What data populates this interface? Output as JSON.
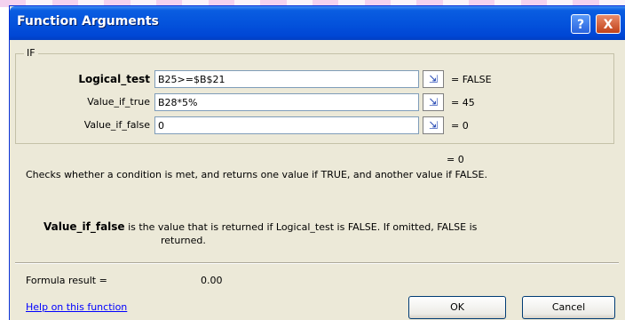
{
  "window": {
    "title": "Function Arguments"
  },
  "titlebar_buttons": {
    "help": "?",
    "close": "X"
  },
  "group": {
    "label": "IF"
  },
  "arguments": [
    {
      "label": "Logical_test",
      "value": "B25>=$B$21",
      "result": "= FALSE"
    },
    {
      "label": "Value_if_true",
      "value": "B28*5%",
      "result": "= 45"
    },
    {
      "label": "Value_if_false",
      "value": "0",
      "result": "= 0"
    }
  ],
  "overall_result": "= 0",
  "description": "Checks whether a condition is met, and returns one value if TRUE, and another value if FALSE.",
  "arg_help": {
    "name": "Value_if_false",
    "text": "is the value that is returned if Logical_test is FALSE. If omitted, FALSE is",
    "text_cont": "returned."
  },
  "formula": {
    "label": "Formula result =",
    "value": "0.00"
  },
  "help_link": "Help on this function",
  "buttons": {
    "ok": "OK",
    "cancel": "Cancel"
  },
  "colors": {
    "titlebar": "#0453dc",
    "dialog_bg": "#ece9d8",
    "link": "#0000ff",
    "stripe": "#f4d2ef"
  },
  "icons": {
    "collapse": "collapse-dialog-icon",
    "help": "question-mark-icon",
    "close": "close-icon"
  }
}
